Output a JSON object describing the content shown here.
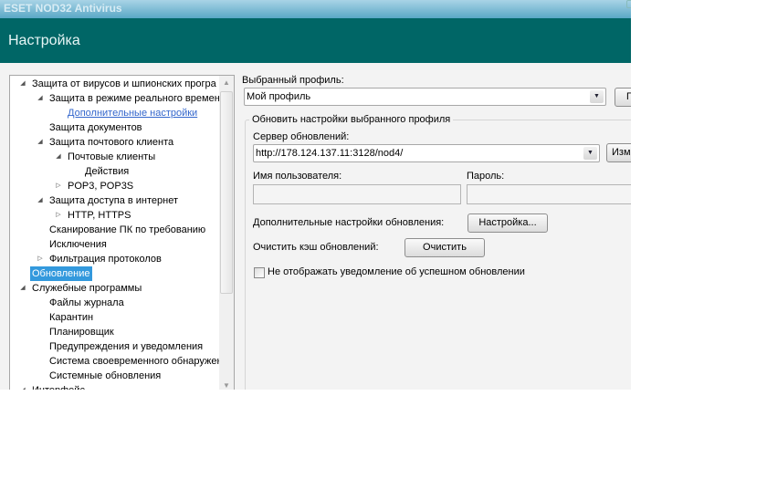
{
  "window": {
    "app_title": "ESET NOD32 Antivirus",
    "header_title": "Настройка"
  },
  "tree": {
    "items": [
      {
        "label": "Защита от вирусов и шпионских програ",
        "level": 0,
        "expander": "expanded"
      },
      {
        "label": "Защита в режиме реального времен",
        "level": 1,
        "expander": "expanded"
      },
      {
        "label": "Дополнительные настройки",
        "level": 2,
        "expander": "none",
        "link": true
      },
      {
        "label": "Защита документов",
        "level": 1,
        "expander": "none"
      },
      {
        "label": "Защита почтового клиента",
        "level": 1,
        "expander": "expanded"
      },
      {
        "label": "Почтовые клиенты",
        "level": 2,
        "expander": "expanded"
      },
      {
        "label": "Действия",
        "level": 3,
        "expander": "none"
      },
      {
        "label": "POP3, POP3S",
        "level": 2,
        "expander": "collapsed"
      },
      {
        "label": "Защита доступа в интернет",
        "level": 1,
        "expander": "expanded"
      },
      {
        "label": "HTTP, HTTPS",
        "level": 2,
        "expander": "collapsed"
      },
      {
        "label": "Сканирование ПК по требованию",
        "level": 1,
        "expander": "none"
      },
      {
        "label": "Исключения",
        "level": 1,
        "expander": "none"
      },
      {
        "label": "Фильтрация протоколов",
        "level": 1,
        "expander": "collapsed"
      },
      {
        "label": "Обновление",
        "level": 0,
        "expander": "none",
        "selected": true
      },
      {
        "label": "Служебные программы",
        "level": 0,
        "expander": "expanded"
      },
      {
        "label": "Файлы журнала",
        "level": 1,
        "expander": "none"
      },
      {
        "label": "Карантин",
        "level": 1,
        "expander": "none"
      },
      {
        "label": "Планировщик",
        "level": 1,
        "expander": "none"
      },
      {
        "label": "Предупреждения и уведомления",
        "level": 1,
        "expander": "none"
      },
      {
        "label": "Система своевременного обнаружен",
        "level": 1,
        "expander": "none"
      },
      {
        "label": "Системные обновления",
        "level": 1,
        "expander": "none"
      },
      {
        "label": "Интерфейс",
        "level": 0,
        "expander": "expanded"
      }
    ]
  },
  "main": {
    "profile_label": "Выбранный профиль:",
    "profile_value": "Мой профиль",
    "profile_button": "Пр",
    "group_title": "Обновить настройки выбранного профиля",
    "server_label": "Сервер обновлений:",
    "server_value": "http://178.124.137.11:3128/nod4/",
    "server_button": "Изме",
    "username_label": "Имя пользователя:",
    "username_value": "",
    "password_label": "Пароль:",
    "password_value": "",
    "advanced_label": "Дополнительные настройки обновления:",
    "advanced_button": "Настройка...",
    "clear_label": "Очистить кэш обновлений:",
    "clear_button": "Очистить",
    "notify_checkbox_label": "Не отображать уведомление об успешном обновлении",
    "notify_checked": false
  },
  "colors": {
    "header": "#006666",
    "selection": "#3399dd",
    "link": "#3366cc"
  }
}
